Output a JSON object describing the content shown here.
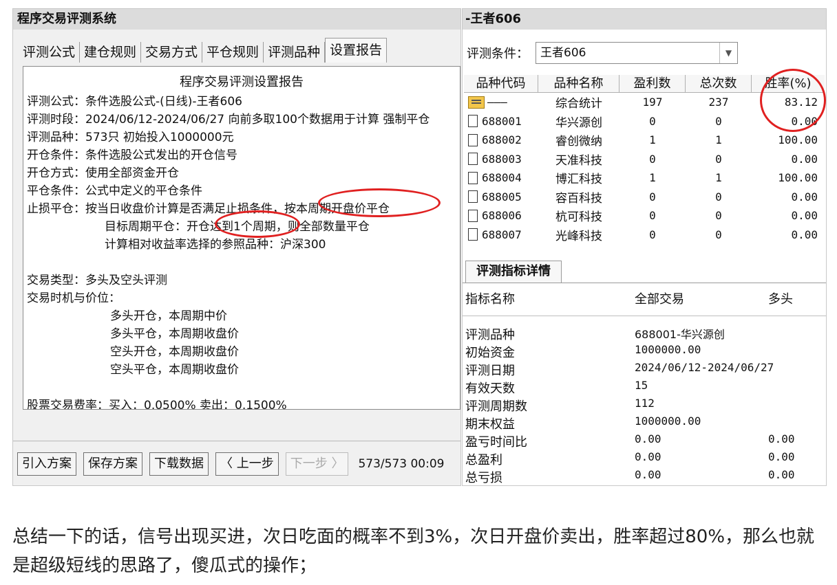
{
  "left": {
    "title": "程序交易评测系统",
    "tabs": [
      "评测公式",
      "建仓规则",
      "交易方式",
      "平仓规则",
      "评测品种",
      "设置报告"
    ],
    "report": {
      "title": "程序交易评测设置报告",
      "lines": [
        "评测公式：条件选股公式-(日线)-王者606",
        "评测时段：2024/06/12-2024/06/27 向前多取100个数据用于计算 强制平仓",
        "评测品种：573只 初始投入1000000元",
        "开仓条件：条件选股公式发出的开仓信号",
        "开仓方式：使用全部资金开仓",
        "平仓条件：公式中定义的平仓条件",
        "止损平仓：按当日收盘价计算是否满足止损条件，按本周期开盘价平仓",
        "目标周期平仓：开仓达到1个周期，则全部数量平仓",
        "计算相对收益率选择的参照品种：沪深300",
        "交易类型：多头及空头评测",
        "交易时机与价位：",
        "多头开仓，本周期中价",
        "多头平仓，本周期收盘价",
        "空头开仓，本周期收盘价",
        "空头平仓，本周期收盘价",
        "股票交易费率：买入：0.0500% 卖出：0.1500%"
      ]
    },
    "buttons": {
      "import": "引入方案",
      "save": "保存方案",
      "download": "下载数据",
      "prev": "〈 上一步",
      "next": "下一步 〉"
    },
    "counter": "573/573 00:09"
  },
  "right": {
    "title": "-王者606",
    "condition_label": "评测条件：",
    "condition_value": "王者606",
    "columns": [
      "品种代码",
      "品种名称",
      "盈利数",
      "总次数",
      "胜率(%)"
    ],
    "summary_row": {
      "code": "———",
      "name": "综合统计",
      "profit": "197",
      "total": "237",
      "rate": "83.12"
    },
    "rows": [
      {
        "code": "688001",
        "name": "华兴源创",
        "profit": "0",
        "total": "0",
        "rate": "0.00"
      },
      {
        "code": "688002",
        "name": "睿创微纳",
        "profit": "1",
        "total": "1",
        "rate": "100.00"
      },
      {
        "code": "688003",
        "name": "天准科技",
        "profit": "0",
        "total": "0",
        "rate": "0.00"
      },
      {
        "code": "688004",
        "name": "博汇科技",
        "profit": "1",
        "total": "1",
        "rate": "100.00"
      },
      {
        "code": "688005",
        "name": "容百科技",
        "profit": "0",
        "total": "0",
        "rate": "0.00"
      },
      {
        "code": "688006",
        "name": "杭可科技",
        "profit": "0",
        "total": "0",
        "rate": "0.00"
      },
      {
        "code": "688007",
        "name": "光峰科技",
        "profit": "0",
        "total": "0",
        "rate": "0.00"
      }
    ],
    "detail_tab": "评测指标详情",
    "detail_headers": [
      "指标名称",
      "全部交易",
      "多头"
    ],
    "detail_rows": [
      {
        "name": "评测品种",
        "all": "688001-华兴源创",
        "long": ""
      },
      {
        "name": "初始资金",
        "all": "1000000.00",
        "long": ""
      },
      {
        "name": "评测日期",
        "all": "2024/06/12-2024/06/27",
        "long": ""
      },
      {
        "name": "有效天数",
        "all": "15",
        "long": ""
      },
      {
        "name": "评测周期数",
        "all": "112",
        "long": ""
      },
      {
        "name": "期末权益",
        "all": "1000000.00",
        "long": ""
      },
      {
        "name": "盈亏时间比",
        "all": "0.00",
        "long": "0.00"
      },
      {
        "name": "总盈利",
        "all": "0.00",
        "long": "0.00"
      },
      {
        "name": "总亏损",
        "all": "0.00",
        "long": "0.00"
      }
    ]
  },
  "caption": "总结一下的话，信号出现买进，次日吃面的概率不到3%，次日开盘价卖出，胜率超过80%，那么也就是超级短线的思路了，傻瓜式的操作；",
  "colors": {
    "annotation": "#e02020",
    "folder": "#f3c64a"
  },
  "icons": {
    "summary": "folder-icon",
    "row": "document-icon"
  }
}
